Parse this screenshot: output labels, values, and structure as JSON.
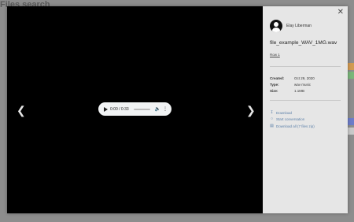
{
  "background": {
    "page_title": "Files search",
    "strip_colors": [
      "#e0a24f",
      "#7fbf7f",
      "#6d7cc8",
      "#e57373"
    ]
  },
  "viewer": {
    "prev_icon": "chevron-left-icon",
    "next_icon": "chevron-right-icon",
    "player": {
      "time": "0:00 / 0:33",
      "progress_fraction": 0.0
    }
  },
  "panel": {
    "close_icon": "close-icon",
    "user": "Elay Liberman",
    "file_name": "file_example_WAV_1MG.wav",
    "file_link": "Row 1",
    "meta": [
      {
        "key": "Created:",
        "value": "Oct 29, 2020"
      },
      {
        "key": "Type:",
        "value": "wav music"
      },
      {
        "key": "Size:",
        "value": "1.1MB"
      }
    ],
    "actions": [
      {
        "label": "Download",
        "icon": "download-icon"
      },
      {
        "label": "Start conversation",
        "icon": "chat-icon"
      },
      {
        "label": "Download all (7 files zip)",
        "icon": "file-download-icon"
      }
    ]
  }
}
